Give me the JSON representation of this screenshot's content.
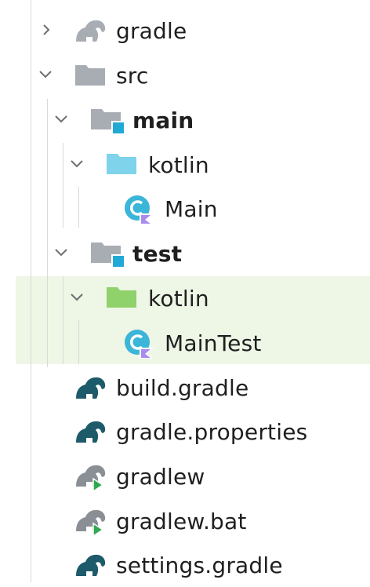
{
  "colors": {
    "selection_bg": "#eef6e6",
    "folder_gray": "#a8adb3",
    "folder_blue": "#7fd3ea",
    "folder_green": "#8fd16b",
    "source_marker": "#21a9d6",
    "kotlin_circle": "#3bb5d8",
    "kotlin_tag": "#a98bf0",
    "gradle_dark": "#1d5a6a",
    "gradle_gray": "#8a8f96",
    "run_green": "#2fa84f"
  },
  "tree": {
    "items": [
      {
        "label": "gradle",
        "icon": "gradle-folder-icon",
        "expanded": false
      },
      {
        "label": "src",
        "icon": "folder-icon",
        "expanded": true
      },
      {
        "label": "main",
        "icon": "source-folder-icon",
        "expanded": true
      },
      {
        "label": "kotlin",
        "icon": "kotlin-source-folder-icon",
        "expanded": true
      },
      {
        "label": "Main",
        "icon": "kotlin-class-icon"
      },
      {
        "label": "test",
        "icon": "test-folder-icon",
        "expanded": true
      },
      {
        "label": "kotlin",
        "icon": "kotlin-test-folder-icon",
        "expanded": true
      },
      {
        "label": "MainTest",
        "icon": "kotlin-class-icon"
      },
      {
        "label": "build.gradle",
        "icon": "gradle-file-icon"
      },
      {
        "label": "gradle.properties",
        "icon": "gradle-file-icon"
      },
      {
        "label": "gradlew",
        "icon": "gradle-wrapper-icon"
      },
      {
        "label": "gradlew.bat",
        "icon": "gradle-wrapper-icon"
      },
      {
        "label": "settings.gradle",
        "icon": "gradle-file-icon"
      }
    ]
  }
}
